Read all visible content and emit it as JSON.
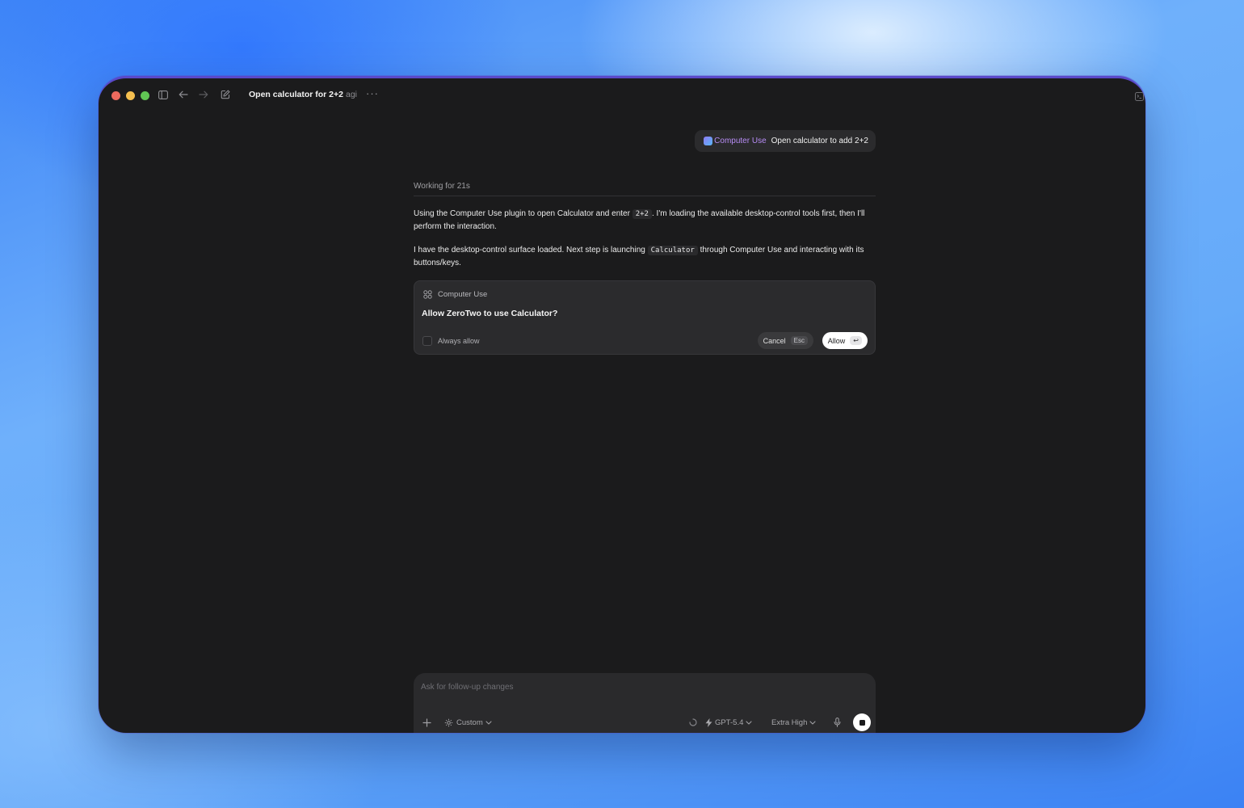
{
  "window": {
    "title": "Open calculator for 2+2",
    "subtitle": "agi",
    "more": "···"
  },
  "user_message": {
    "plugin_label": "Computer Use",
    "text": "Open calculator to add 2+2"
  },
  "assistant": {
    "status": "Working for 21s",
    "para1_a": "Using the Computer Use plugin to open Calculator and enter",
    "para1_code": "2+2",
    "para1_b": ". I'm loading the available desktop-control tools first, then I'll perform the interaction.",
    "para2_a": "I have the desktop-control surface loaded. Next step is launching",
    "para2_code": "Calculator",
    "para2_b": "through Computer Use and interacting with its buttons/keys."
  },
  "permission": {
    "header": "Computer Use",
    "question": "Allow ZeroTwo to use Calculator?",
    "always_allow": "Always allow",
    "cancel_label": "Cancel",
    "cancel_key": "Esc",
    "allow_label": "Allow",
    "allow_key": "↩",
    "always_allow_checked": false
  },
  "composer": {
    "placeholder": "Ask for follow-up changes",
    "mode": "Custom",
    "model": "GPT-5.4",
    "effort": "Extra High"
  },
  "icons": {
    "sidebar": "sidebar-toggle-icon",
    "back": "arrow-left-icon",
    "forward": "arrow-right-icon",
    "compose": "compose-icon",
    "apps": "grid-icon",
    "add": "plus-icon",
    "settings": "gear-icon",
    "model": "lightning-icon",
    "mic": "microphone-icon",
    "stop": "stop-icon"
  },
  "colors": {
    "window_bg": "#1b1b1c",
    "plugin_accent": "#b78cf5",
    "allow_bg": "#ffffff"
  }
}
